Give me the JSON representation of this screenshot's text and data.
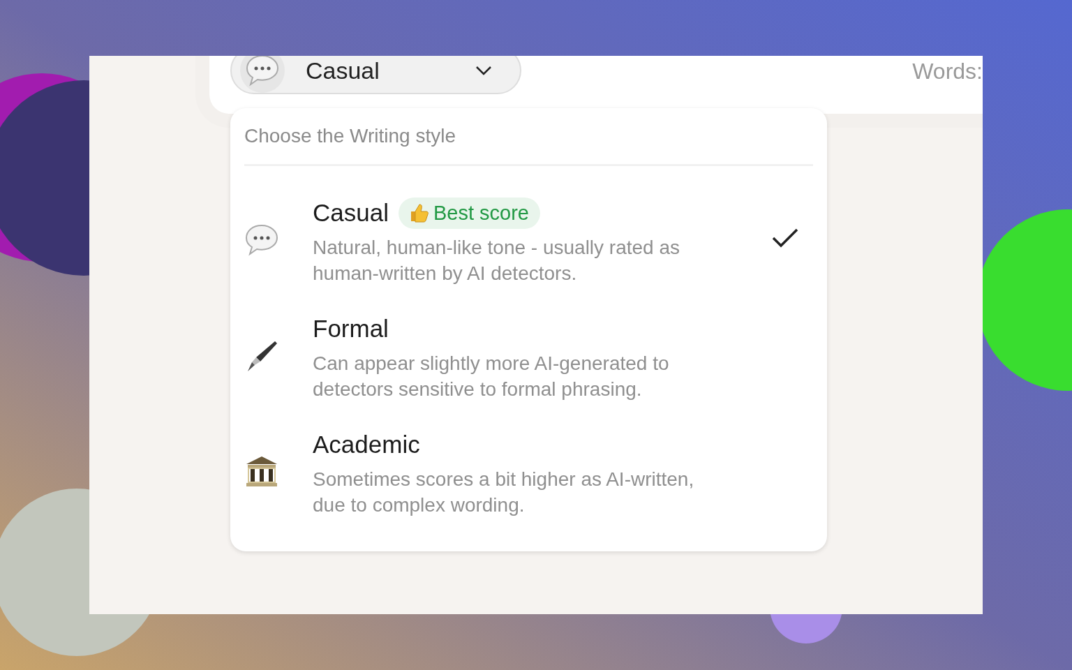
{
  "selector": {
    "value": "Casual"
  },
  "word_count": {
    "label": "Words:"
  },
  "menu": {
    "title": "Choose the Writing style",
    "options": [
      {
        "kind": "speech",
        "title": "Casual",
        "badge": "Best score",
        "description": "Natural, human-like tone - usually rated as human-written by AI detectors.",
        "selected": true
      },
      {
        "kind": "pen",
        "title": "Formal",
        "description": "Can appear slightly more AI-generated to detectors sensitive to formal phrasing.",
        "selected": false
      },
      {
        "kind": "building",
        "title": "Academic",
        "description": "Sometimes scores a bit higher as AI-written, due to complex wording.",
        "selected": false
      }
    ]
  }
}
